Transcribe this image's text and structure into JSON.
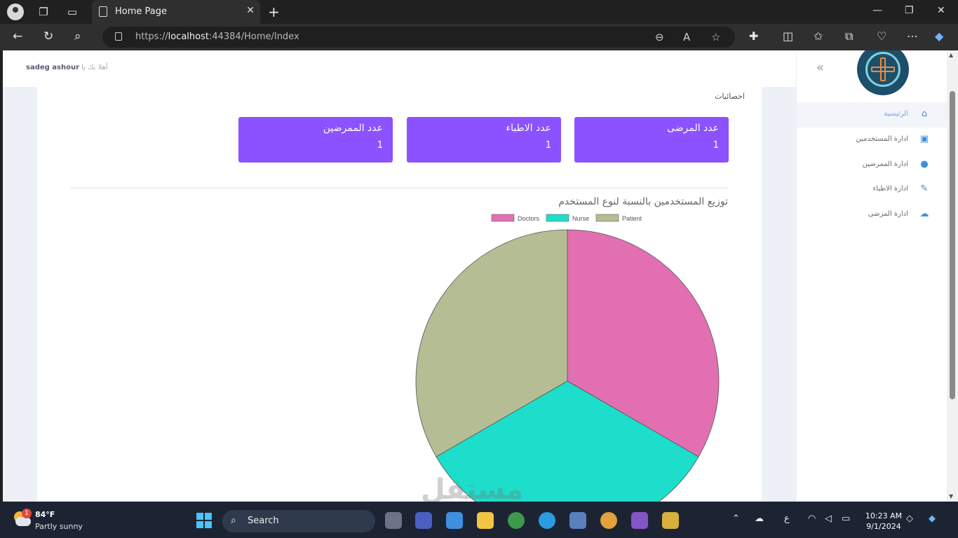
{
  "browser": {
    "tab_title": "Home Page",
    "url_prefix": "https://",
    "url_host": "localhost",
    "url_rest": ":44384/Home/Index",
    "icons": [
      "profile-icon",
      "workspaces-icon",
      "tab-actions-icon",
      "back-icon",
      "refresh-icon",
      "search-icon",
      "zoom-icon",
      "read-aloud-icon",
      "favorite-star-icon",
      "extensions-icon",
      "split-screen-icon",
      "favorites-icon",
      "collections-icon",
      "health-icon",
      "more-icon",
      "copilot-icon"
    ]
  },
  "header": {
    "greeting": "أهلا بك يا",
    "username": "sadeg ashour"
  },
  "sidebar": {
    "items": [
      {
        "label": "الرئيسية",
        "icon": "home-icon",
        "glyph": "⌂"
      },
      {
        "label": "ادارة المستخدمين",
        "icon": "user-folder-icon",
        "glyph": "▣"
      },
      {
        "label": "ادارة الممرضين",
        "icon": "nurse-icon",
        "glyph": "●"
      },
      {
        "label": "ادارة الاطباء",
        "icon": "edit-icon",
        "glyph": "✎"
      },
      {
        "label": "ادارة المرضى",
        "icon": "cloud-icon",
        "glyph": "☁"
      }
    ]
  },
  "main": {
    "section_title": "احصائيات",
    "stats": [
      {
        "label": "عدد المرضى",
        "value": "1"
      },
      {
        "label": "عدد الاطباء",
        "value": "1"
      },
      {
        "label": "عدد الممرضين",
        "value": "1"
      }
    ],
    "chart_title": "توزيع المستخدمين بالنسبة لنوع المستخدم"
  },
  "chart_data": {
    "type": "pie",
    "title": "توزيع المستخدمين بالنسبة لنوع المستخدم",
    "categories": [
      "Doctors",
      "Nurse",
      "Patient"
    ],
    "values": [
      1,
      1,
      1
    ],
    "colors": [
      "#e26fb1",
      "#1ddecb",
      "#b4bd93"
    ],
    "legend": "top"
  },
  "watermark": "مستقل",
  "taskbar": {
    "temperature": "84°F",
    "condition": "Partly sunny",
    "weather_badge": "1",
    "search_label": "Search",
    "language": "ع",
    "time": "10:23 AM",
    "date": "9/1/2024"
  }
}
